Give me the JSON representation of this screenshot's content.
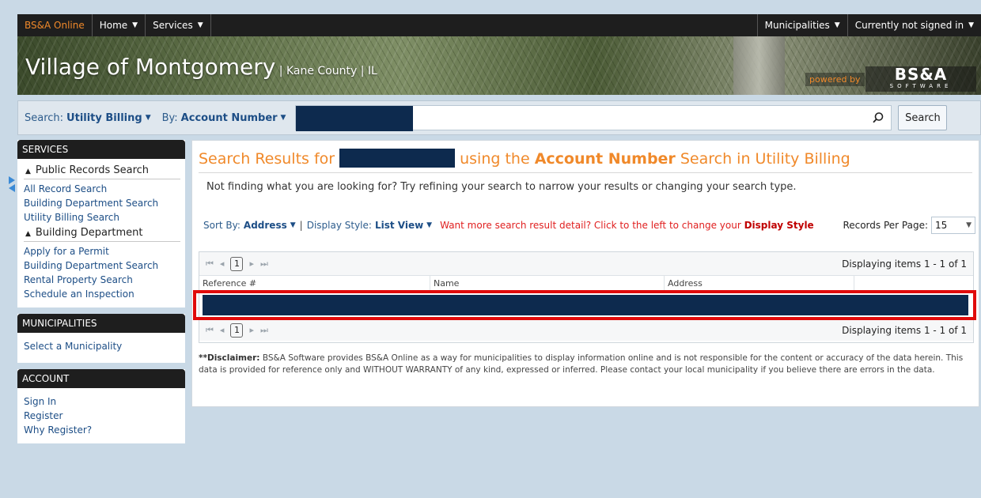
{
  "topnav": {
    "brand": "BS&A Online",
    "home": "Home",
    "services": "Services",
    "municipalities": "Municipalities",
    "signin_status": "Currently not signed in"
  },
  "banner": {
    "title": "Village of Montgomery",
    "subtitle": " | Kane County | IL",
    "powered_by": "powered by",
    "logo_main": "BS&A",
    "logo_sub": "SOFTWARE"
  },
  "searchbar": {
    "search_label": "Search:",
    "search_value": "Utility Billing",
    "by_label": "By:",
    "by_value": "Account Number",
    "button": "Search"
  },
  "sidebar": {
    "services_header": "SERVICES",
    "public_records": "Public Records Search",
    "public_links": [
      "All Record Search",
      "Building Department Search",
      "Utility Billing Search"
    ],
    "building_dept": "Building Department",
    "building_links": [
      "Apply for a Permit",
      "Building Department Search",
      "Rental Property Search",
      "Schedule an Inspection"
    ],
    "municipalities_header": "MUNICIPALITIES",
    "municipalities_links": [
      "Select a Municipality"
    ],
    "account_header": "ACCOUNT",
    "account_links": [
      "Sign In",
      "Register",
      "Why Register?"
    ]
  },
  "results": {
    "title_prefix": "Search Results for",
    "title_mid": "using the",
    "title_bold": "Account Number",
    "title_suffix": "Search in Utility Billing",
    "hint": "Not finding what you are looking for? Try refining your search to narrow your results or changing your search type.",
    "sort_label": "Sort By:",
    "sort_value": "Address",
    "display_label": "Display Style:",
    "display_value": "List View",
    "warn_text": "Want more search result detail? Click to the left to change your",
    "warn_bold": "Display Style",
    "rpp_label": "Records Per Page:",
    "rpp_value": "15",
    "page": "1",
    "displaying": "Displaying items 1 - 1 of 1",
    "columns": [
      "Reference #",
      "Name",
      "Address",
      ""
    ],
    "disclaimer_bold": "**Disclaimer:",
    "disclaimer_text": "BS&A Software provides BS&A Online as a way for municipalities to display information online and is not responsible for the content or accuracy of the data herein. This data is provided for reference only and WITHOUT WARRANTY of any kind, expressed or inferred. Please contact your local municipality if you believe there are errors in the data."
  },
  "colors": {
    "accent_orange": "#f0892a",
    "link_blue": "#1d4e86",
    "redaction": "#0d2a4e",
    "highlight_red": "#e00b0b"
  }
}
